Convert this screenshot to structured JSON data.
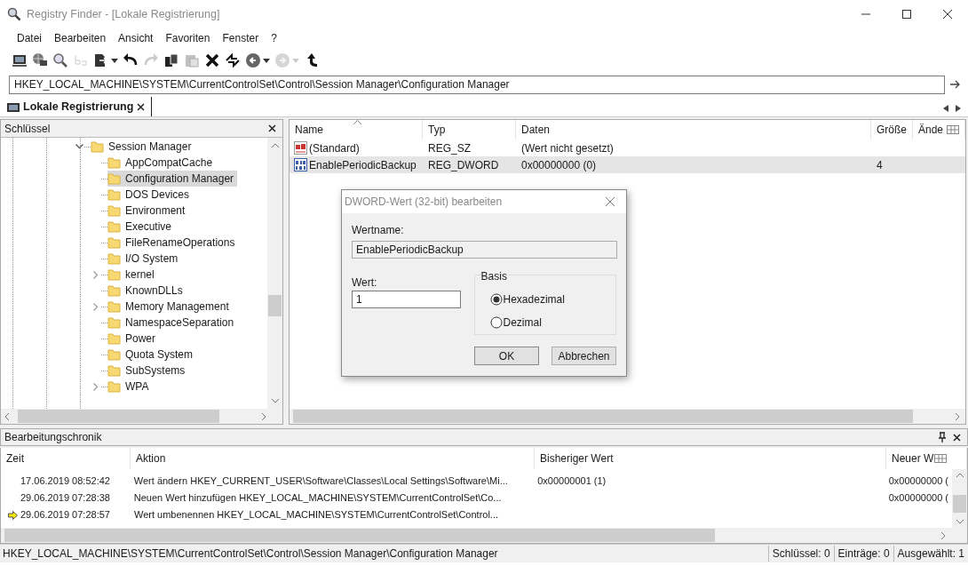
{
  "window": {
    "title": "Registry Finder - [Lokale Registrierung]"
  },
  "menu": [
    "Datei",
    "Bearbeiten",
    "Ansicht",
    "Favoriten",
    "Fenster",
    "?"
  ],
  "toolbar": [
    {
      "kind": "computer",
      "disabled": false,
      "dropdown": false
    },
    {
      "kind": "network",
      "disabled": false,
      "dropdown": false
    },
    {
      "kind": "search",
      "disabled": false,
      "dropdown": false
    },
    {
      "kind": "rename",
      "disabled": true,
      "dropdown": false
    },
    {
      "kind": "export",
      "disabled": false,
      "dropdown": true
    },
    {
      "kind": "undo",
      "disabled": false,
      "dropdown": false
    },
    {
      "kind": "redo",
      "disabled": true,
      "dropdown": false
    },
    {
      "kind": "copy",
      "disabled": false,
      "dropdown": false
    },
    {
      "kind": "paste",
      "disabled": true,
      "dropdown": false
    },
    {
      "kind": "delete",
      "disabled": false,
      "dropdown": false
    },
    {
      "kind": "replace",
      "disabled": false,
      "dropdown": false
    },
    {
      "kind": "back",
      "disabled": false,
      "dropdown": true
    },
    {
      "kind": "forward",
      "disabled": true,
      "dropdown": true
    },
    {
      "kind": "up",
      "disabled": false,
      "dropdown": false
    }
  ],
  "address": {
    "value": "HKEY_LOCAL_MACHINE\\SYSTEM\\CurrentControlSet\\Control\\Session Manager\\Configuration Manager"
  },
  "tabs": [
    {
      "label": "Lokale Registrierung",
      "selected": true
    }
  ],
  "keys_panel": {
    "title": "Schlüssel",
    "tree": [
      {
        "label": "Session Manager",
        "expandable": true,
        "expanded": true,
        "selected": false,
        "children": [
          {
            "label": "AppCompatCache",
            "expandable": false,
            "selected": false
          },
          {
            "label": "Configuration Manager",
            "expandable": false,
            "selected": true
          },
          {
            "label": "DOS Devices",
            "expandable": false,
            "selected": false
          },
          {
            "label": "Environment",
            "expandable": false,
            "selected": false
          },
          {
            "label": "Executive",
            "expandable": false,
            "selected": false
          },
          {
            "label": "FileRenameOperations",
            "expandable": false,
            "selected": false
          },
          {
            "label": "I/O System",
            "expandable": false,
            "selected": false
          },
          {
            "label": "kernel",
            "expandable": true,
            "expanded": false,
            "selected": false
          },
          {
            "label": "KnownDLLs",
            "expandable": false,
            "selected": false
          },
          {
            "label": "Memory Management",
            "expandable": true,
            "expanded": false,
            "selected": false
          },
          {
            "label": "NamespaceSeparation",
            "expandable": false,
            "selected": false
          },
          {
            "label": "Power",
            "expandable": false,
            "selected": false
          },
          {
            "label": "Quota System",
            "expandable": false,
            "selected": false
          },
          {
            "label": "SubSystems",
            "expandable": false,
            "selected": false
          },
          {
            "label": "WPA",
            "expandable": true,
            "expanded": false,
            "selected": false
          }
        ]
      }
    ]
  },
  "values_table": {
    "columns": [
      "Name",
      "Typ",
      "Daten",
      "Größe",
      "Ände"
    ],
    "rows": [
      {
        "kind": "string",
        "name": "(Standard)",
        "type": "REG_SZ",
        "data": "(Wert nicht gesetzt)",
        "size": "",
        "selected": false
      },
      {
        "kind": "binary",
        "name": "EnablePeriodicBackup",
        "type": "REG_DWORD",
        "data": "0x00000000 (0)",
        "size": "4",
        "selected": true
      }
    ]
  },
  "dialog": {
    "title": "DWORD-Wert (32-bit) bearbeiten",
    "name_label": "Wertname:",
    "name_value": "EnablePeriodicBackup",
    "value_label": "Wert:",
    "value": "1",
    "base_label": "Basis",
    "bases": [
      {
        "label": "Hexadezimal",
        "selected": true
      },
      {
        "label": "Dezimal",
        "selected": false
      }
    ],
    "buttons": [
      "OK",
      "Abbrechen"
    ]
  },
  "history": {
    "title": "Bearbeitungschronik",
    "columns": [
      "Zeit",
      "Aktion",
      "Bisheriger Wert",
      "Neuer W"
    ],
    "rows": [
      {
        "current": false,
        "time": "17.06.2019 08:52:42",
        "action": "Wert ändern HKEY_CURRENT_USER\\Software\\Classes\\Local Settings\\Software\\Mi...",
        "old": "0x00000001 (1)",
        "new": "0x00000000 ("
      },
      {
        "current": false,
        "time": "29.06.2019 07:28:38",
        "action": "Neuen Wert hinzufügen HKEY_LOCAL_MACHINE\\SYSTEM\\CurrentControlSet\\Co...",
        "old": "",
        "new": "0x00000000 ("
      },
      {
        "current": true,
        "time": "29.06.2019 07:28:57",
        "action": "Wert umbenennen HKEY_LOCAL_MACHINE\\SYSTEM\\CurrentControlSet\\Control...",
        "old": "",
        "new": ""
      }
    ]
  },
  "status_bar": {
    "path": "HKEY_LOCAL_MACHINE\\SYSTEM\\CurrentControlSet\\Control\\Session Manager\\Configuration Manager",
    "keys": "Schlüssel: 0",
    "entries": "Einträge: 0",
    "selected": "Ausgewählt: 1"
  }
}
